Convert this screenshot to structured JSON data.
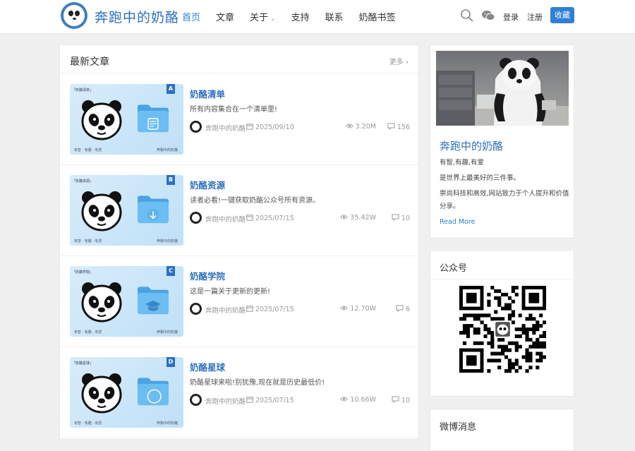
{
  "header": {
    "site_title": "奔跑中的奶酪",
    "nav": [
      {
        "label": "首页",
        "active": true
      },
      {
        "label": "文章",
        "active": false
      },
      {
        "label": "关于",
        "active": false,
        "has_dropdown": true
      },
      {
        "label": "支持",
        "active": false
      },
      {
        "label": "联系",
        "active": false
      },
      {
        "label": "奶酪书签",
        "active": false
      }
    ],
    "icons": [
      "search-icon",
      "wechat-icon"
    ],
    "login": "登录",
    "register": "注册",
    "favorite": "收藏",
    "accent_color": "#2f7fd4"
  },
  "main": {
    "section_title": "最新文章",
    "more": "更多",
    "posts": [
      {
        "badge": "A",
        "thumb_tag": "「奶酪清单」",
        "thumb_left": "有智 · 有趣 · 有爱",
        "thumb_right": "奔跑中的奶酪",
        "folder_icon": "document-icon",
        "title": "奶酪清单",
        "desc": "所有内容集合在一个清单里!",
        "author": "奔跑中的奶酪",
        "date": "2025/09/10",
        "views": "3.20M",
        "comments": "156"
      },
      {
        "badge": "B",
        "thumb_tag": "「奶酪资源」",
        "thumb_left": "有智 · 有趣 · 有爱",
        "thumb_right": "奔跑中的奶酪",
        "folder_icon": "download-icon",
        "title": "奶酪资源",
        "desc": "读者必看!一键获取奶酪公众号所有资源。",
        "author": "奔跑中的奶酪",
        "date": "2025/07/15",
        "views": "35.42W",
        "comments": "10"
      },
      {
        "badge": "C",
        "thumb_tag": "「奶酪学院」",
        "thumb_left": "有智 · 有趣 · 有爱",
        "thumb_right": "奔跑中的奶酪",
        "folder_icon": "graduation-cap-icon",
        "title": "奶酪学院",
        "desc": "这是一篇关于更新的更新!",
        "author": "奔跑中的奶酪",
        "date": "2025/07/15",
        "views": "12.70W",
        "comments": "6"
      },
      {
        "badge": "D",
        "thumb_tag": "「奶酪星球」",
        "thumb_left": "有智 · 有趣 · 有爱",
        "thumb_right": "奔跑中的奶酪",
        "folder_icon": "circle-icon",
        "title": "奶酪星球",
        "desc": "奶酪星球来啦!别犹豫,现在就是历史最低价!",
        "author": "奔跑中的奶酪",
        "date": "2025/07/15",
        "views": "10.66W",
        "comments": "10"
      }
    ]
  },
  "sidebar": {
    "profile": {
      "name": "奔跑中的奶酪",
      "line1": "有智,有趣,有爱",
      "line2": "是世界上最美好的三件事。",
      "line3": "崇尚科技和高效,网站致力于个人提升和价值分享。",
      "read_more": "Read More"
    },
    "wechat": {
      "title": "公众号"
    },
    "weibo": {
      "title": "微博消息"
    }
  }
}
